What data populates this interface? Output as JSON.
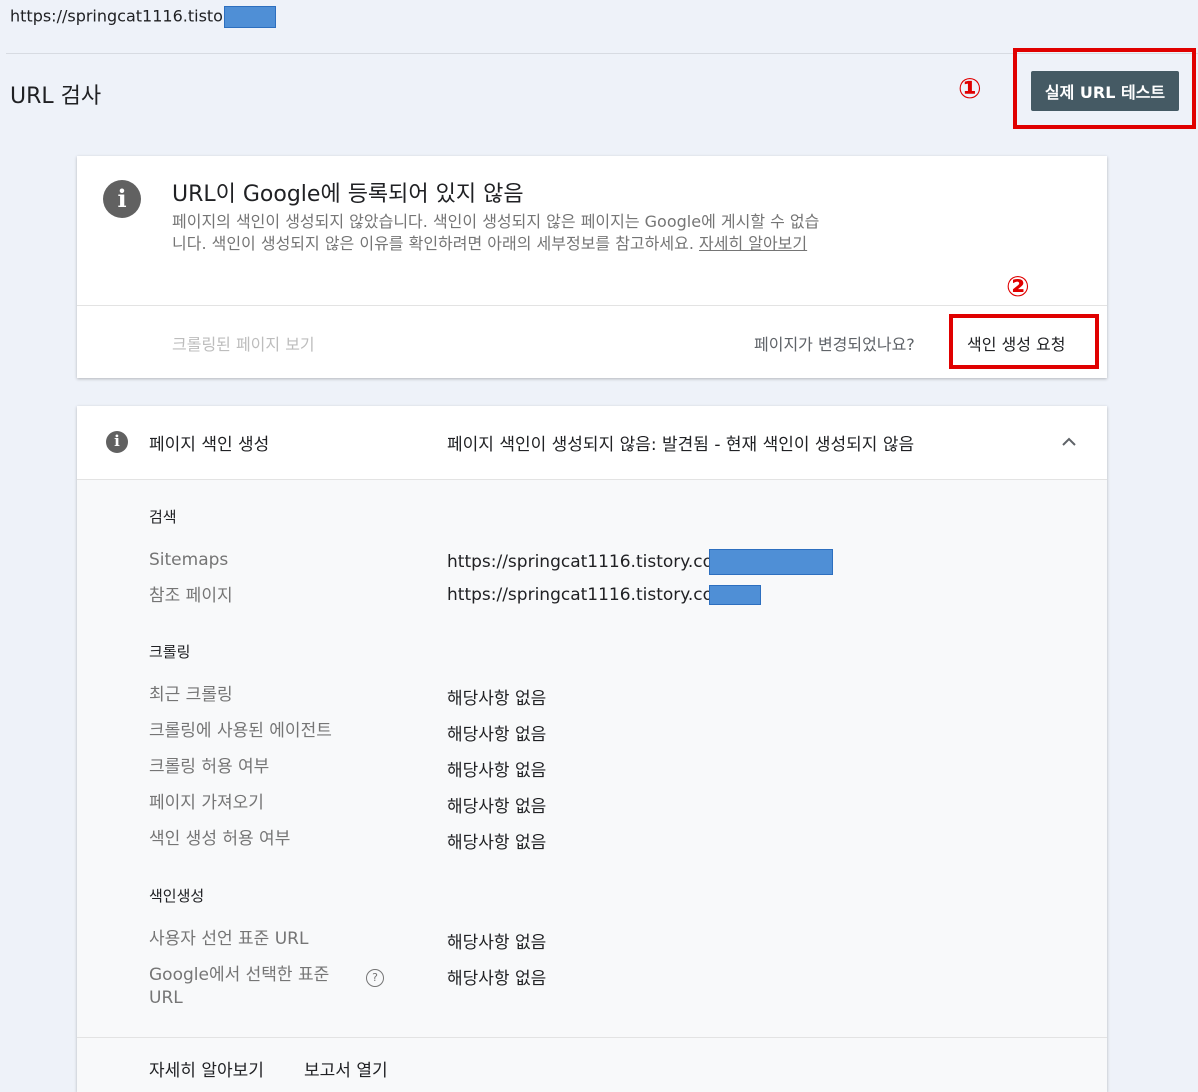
{
  "top_url": "https://springcat1116.tistory.com",
  "page_title": "URL 검사",
  "live_test_button": "실제 URL 테스트",
  "annotations": {
    "one": "①",
    "two": "②",
    "color": "#e00000"
  },
  "status_card": {
    "title": "URL이 Google에 등록되어 있지 않음",
    "description": "페이지의 색인이 생성되지 않았습니다. 색인이 생성되지 않은 페이지는 Google에 게시할 수 없습니다. 색인이 생성되지 않은 이유를 확인하려면 아래의 세부정보를 참고하세요.",
    "learn_more": "자세히 알아보기",
    "view_crawled": "크롤링된 페이지 보기",
    "changed_question": "페이지가 변경되었나요?",
    "request_indexing": "색인 생성 요청"
  },
  "details": {
    "section_label": "페이지 색인 생성",
    "section_status": "페이지 색인이 생성되지 않음: 발견됨 - 현재 색인이 생성되지 않음",
    "groups": {
      "search": {
        "heading": "검색",
        "sitemaps_label": "Sitemaps",
        "sitemaps_value": "https://springcat1116.tistory.co",
        "referring_label": "참조 페이지",
        "referring_value": "https://springcat1116.tistory.co"
      },
      "crawl": {
        "heading": "크롤링",
        "rows": [
          {
            "label": "최근 크롤링",
            "value": "해당사항 없음"
          },
          {
            "label": "크롤링에 사용된 에이전트",
            "value": "해당사항 없음"
          },
          {
            "label": "크롤링 허용 여부",
            "value": "해당사항 없음"
          },
          {
            "label": "페이지 가져오기",
            "value": "해당사항 없음"
          },
          {
            "label": "색인 생성 허용 여부",
            "value": "해당사항 없음"
          }
        ]
      },
      "indexing": {
        "heading": "색인생성",
        "rows": [
          {
            "label": "사용자 선언 표준 URL",
            "value": "해당사항 없음"
          },
          {
            "label": "Google에서 선택한 표준 URL",
            "value": "해당사항 없음"
          }
        ]
      }
    },
    "footer": {
      "learn_more": "자세히 알아보기",
      "open_report": "보고서 열기"
    }
  },
  "colors": {
    "background": "#eef2f9",
    "button": "#455a64",
    "redaction": "#4f8fd6"
  }
}
